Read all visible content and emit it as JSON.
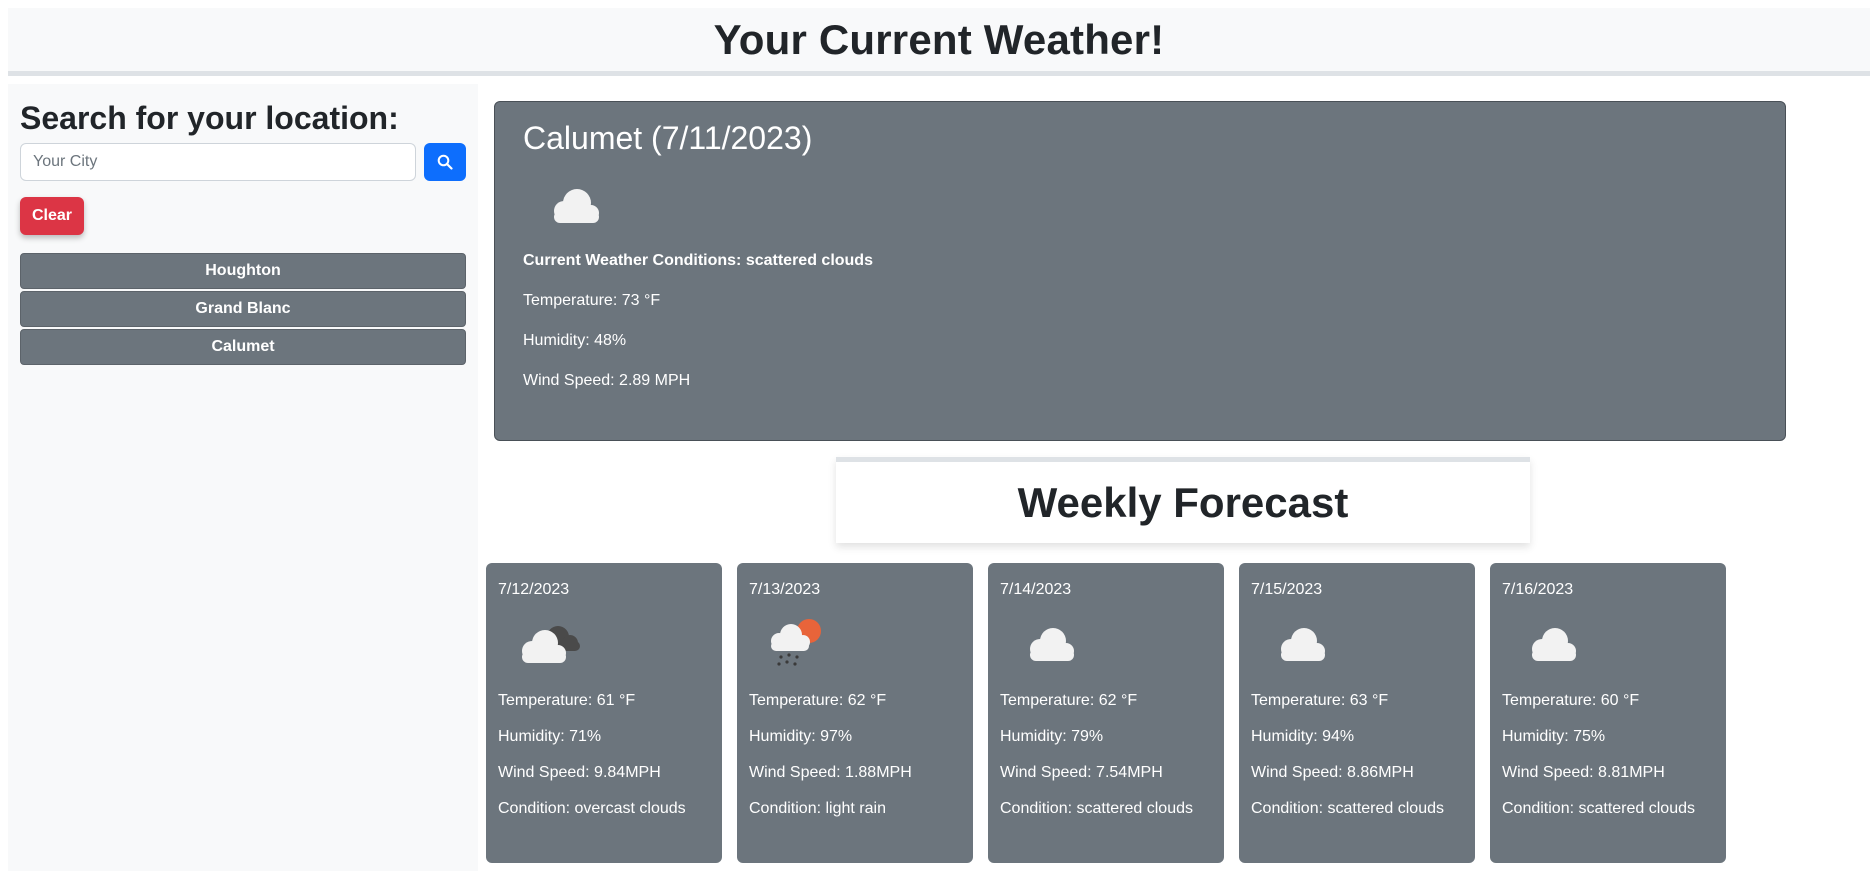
{
  "header": {
    "title": "Your Current Weather!"
  },
  "sidebar": {
    "heading": "Search for your location:",
    "search": {
      "placeholder": "Your City",
      "value": ""
    },
    "clear_label": "Clear",
    "history": [
      {
        "label": "Houghton"
      },
      {
        "label": "Grand Blanc"
      },
      {
        "label": "Calumet"
      }
    ]
  },
  "current": {
    "title": "Calumet (7/11/2023)",
    "icon": "cloud-icon",
    "conditions": "Current Weather Conditions: scattered clouds",
    "temperature": "Temperature: 73 °F",
    "humidity": "Humidity: 48%",
    "wind": "Wind Speed: 2.89 MPH"
  },
  "forecast": {
    "heading": "Weekly Forecast",
    "days": [
      {
        "date": "7/12/2023",
        "icon": "overcast-clouds-icon",
        "temperature": "Temperature: 61 °F",
        "humidity": "Humidity: 71%",
        "wind": "Wind Speed: 9.84MPH",
        "condition": "Condition: overcast clouds"
      },
      {
        "date": "7/13/2023",
        "icon": "light-rain-icon",
        "temperature": "Temperature: 62 °F",
        "humidity": "Humidity: 97%",
        "wind": "Wind Speed: 1.88MPH",
        "condition": "Condition: light rain"
      },
      {
        "date": "7/14/2023",
        "icon": "cloud-icon",
        "temperature": "Temperature: 62 °F",
        "humidity": "Humidity: 79%",
        "wind": "Wind Speed: 7.54MPH",
        "condition": "Condition: scattered clouds"
      },
      {
        "date": "7/15/2023",
        "icon": "cloud-icon",
        "temperature": "Temperature: 63 °F",
        "humidity": "Humidity: 94%",
        "wind": "Wind Speed: 8.86MPH",
        "condition": "Condition: scattered clouds"
      },
      {
        "date": "7/16/2023",
        "icon": "cloud-icon",
        "temperature": "Temperature: 60 °F",
        "humidity": "Humidity: 75%",
        "wind": "Wind Speed: 8.81MPH",
        "condition": "Condition: scattered clouds"
      }
    ]
  },
  "colors": {
    "card": "#6c757d",
    "primary": "#0d6efd",
    "danger": "#dc3545",
    "header_bg": "#f8f9fa"
  }
}
